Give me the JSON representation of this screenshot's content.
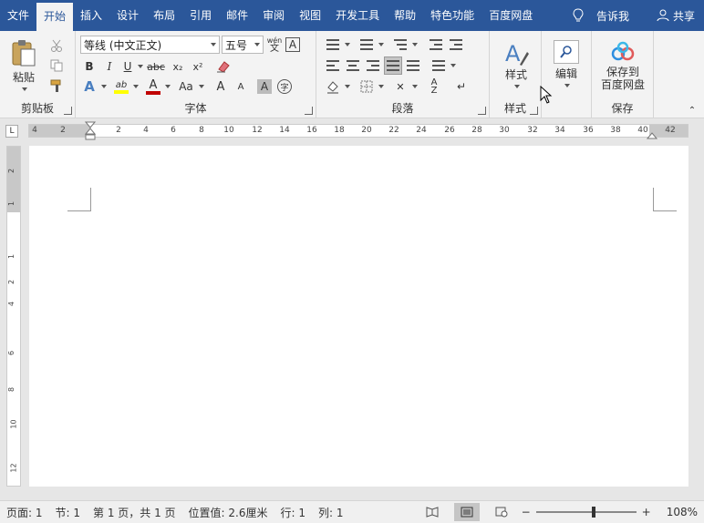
{
  "menu": {
    "tabs": [
      "文件",
      "开始",
      "插入",
      "设计",
      "布局",
      "引用",
      "邮件",
      "审阅",
      "视图",
      "开发工具",
      "帮助",
      "特色功能",
      "百度网盘"
    ],
    "active": "开始",
    "tell_me": "告诉我",
    "share": "共享"
  },
  "ribbon": {
    "clipboard": {
      "label": "剪贴板",
      "paste": "粘贴"
    },
    "font": {
      "label": "字体",
      "font_name": "等线 (中文正文)",
      "font_size": "五号",
      "wen_glyph": "wén",
      "wen_char": "文",
      "bold": "B",
      "italic": "I",
      "underline": "U",
      "strike": "abc",
      "subscript": "x₂",
      "superscript": "x²",
      "text_effects": "A",
      "highlight": "ab",
      "font_color": "A",
      "change_case": "Aa",
      "grow": "A",
      "shrink": "A",
      "shading": "A",
      "enclose": "字"
    },
    "paragraph": {
      "label": "段落"
    },
    "styles": {
      "label": "样式",
      "button": "样式"
    },
    "editing": {
      "button": "编辑"
    },
    "save": {
      "label": "保存",
      "button_line1": "保存到",
      "button_line2": "百度网盘"
    }
  },
  "ruler": {
    "corner": "L",
    "h_ticks": [
      "4",
      "2",
      "2",
      "4",
      "6",
      "8",
      "10",
      "12",
      "14",
      "16",
      "18",
      "20",
      "22",
      "24",
      "26",
      "28",
      "30",
      "32",
      "34",
      "36",
      "38",
      "40",
      "42"
    ],
    "v_ticks": [
      "2",
      "1",
      "1",
      "2",
      "4",
      "6",
      "8",
      "10",
      "12"
    ]
  },
  "status": {
    "page": "页面: 1",
    "section": "节: 1",
    "pages": "第 1 页，共 1 页",
    "position": "位置值: 2.6厘米",
    "line": "行: 1",
    "column": "列: 1",
    "zoom_minus": "−",
    "zoom_plus": "+",
    "zoom": "108%",
    "zoom_fraction": 0.58
  },
  "colors": {
    "brand": "#2b579a",
    "highlight": "#ffff00",
    "font_color": "#c00000"
  }
}
